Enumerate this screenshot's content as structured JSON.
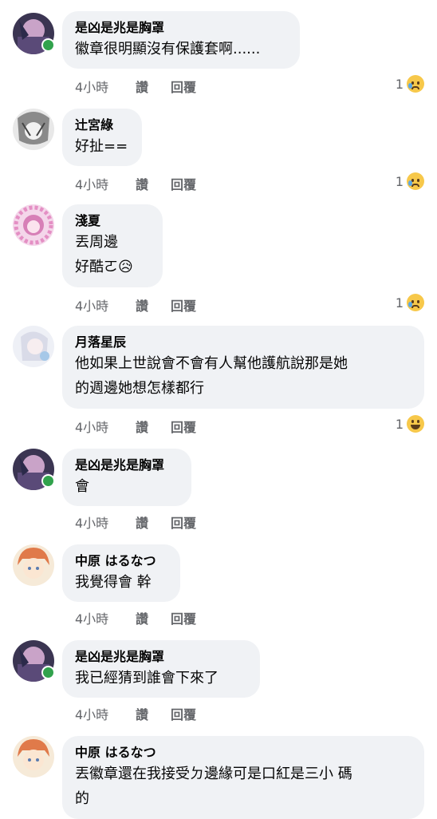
{
  "labels": {
    "like": "讚",
    "reply": "回覆"
  },
  "comments": [
    {
      "name": "是凶是兆是胸罩",
      "lines": [
        "徽章很明顯沒有保護套啊......"
      ],
      "time": "4小時",
      "reactions": "1",
      "reaction_icon": "sad-tear-emoji",
      "online": true
    },
    {
      "name": "辻宮綠",
      "lines": [
        "好扯=="
      ],
      "time": "4小時",
      "reactions": "1",
      "reaction_icon": "sad-tear-emoji",
      "online": false
    },
    {
      "name": "淺夏",
      "lines": [
        "丟周邊",
        "好酷ㄛ😥"
      ],
      "time": "4小時",
      "reactions": "1",
      "reaction_icon": "sad-tear-emoji",
      "online": false
    },
    {
      "name": "月落星辰",
      "lines": [
        "他如果上世說會不會有人幫他護航說那是她",
        "的週邊她想怎樣都行"
      ],
      "time": "4小時",
      "reactions": "1",
      "reaction_icon": "laughing-emoji",
      "online": false
    },
    {
      "name": "是凶是兆是胸罩",
      "lines": [
        "會"
      ],
      "time": "4小時",
      "reactions": "",
      "reaction_icon": "",
      "online": true
    },
    {
      "name": "中原 はるなつ",
      "lines": [
        "我覺得會 幹"
      ],
      "time": "4小時",
      "reactions": "",
      "reaction_icon": "",
      "online": false
    },
    {
      "name": "是凶是兆是胸罩",
      "lines": [
        "我已經猜到誰會下來了"
      ],
      "time": "4小時",
      "reactions": "",
      "reaction_icon": "",
      "online": true
    },
    {
      "name": "中原 はるなつ",
      "lines": [
        "丟徽章還在我接受ㄉ邊緣可是口紅是三小 碼",
        "的"
      ],
      "time": "",
      "reactions": "",
      "reaction_icon": "",
      "online": false
    }
  ]
}
